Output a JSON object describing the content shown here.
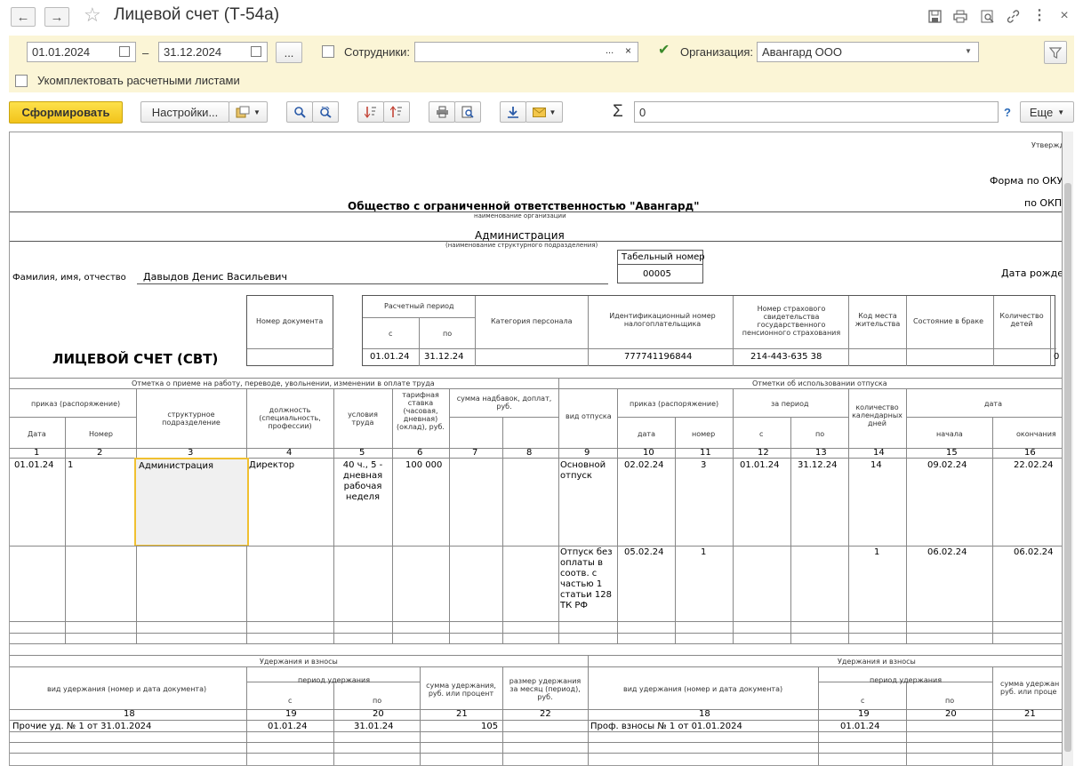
{
  "window": {
    "title": "Лицевой счет (Т-54а)",
    "nav_back": "←",
    "nav_forward": "→",
    "star": "☆"
  },
  "filter": {
    "date_from": "01.01.2024",
    "dash": "–",
    "date_to": "31.12.2024",
    "dots": "...",
    "employees_label": "Сотрудники:",
    "employees_value": "",
    "x": "×",
    "org_label": "Организация:",
    "org_value": "Авангард ООО",
    "complete_label": "Укомплектовать расчетными листами"
  },
  "toolbar": {
    "generate": "Сформировать",
    "settings": "Настройки...",
    "sigma": "Σ",
    "sum_value": "0",
    "help": "?",
    "more": "Еще"
  },
  "doc": {
    "approved": "Утвержд",
    "okud": "Форма по ОКУ",
    "okpo": "по ОКП",
    "org": "Общество с ограниченной ответственностью \"Авангард\"",
    "org_caption": "наименование организации",
    "dept": "Администрация",
    "dept_caption": "(наименование структурного подразделения)",
    "tab_label": "Табельный номер",
    "tab_num": "00005",
    "fio_label": "Фамилия, имя, отчество",
    "fio": "Давыдов Денис Васильевич",
    "birth": "Дата рожден",
    "heading": "ЛИЦЕВОЙ СЧЕТ (СВТ)",
    "h_docnum": "Номер документа",
    "h_period": "Расчетный период",
    "h_from": "с",
    "h_to": "по",
    "h_category": "Категория персонала",
    "h_inn": "Идентификационный номер налогоплательщика",
    "h_snils": "Номер страхового свидетельства государственного пенсионного страхования",
    "h_residence": "Код места жительства",
    "h_marital": "Состояние в браке",
    "h_children": "Количество детей",
    "v_from": "01.01.24",
    "v_to": "31.12.24",
    "v_inn": "777741196844",
    "v_snils": "214-443-635 38",
    "v_zero": "0",
    "sec_hire": "Отметка о приеме на работу, переводе, увольнении, изменении в оплате труда",
    "sec_vac": "Отметки об использовании отпуска",
    "c_order": "приказ (распоряжение)",
    "c_date": "Дата",
    "c_number": "Номер",
    "c_unit": "структурное подразделение",
    "c_position": "должность (специальность, профессии)",
    "c_cond": "условия труда",
    "c_rate": "тарифная ставка (часовая, дневная) (оклад), руб.",
    "c_bonus": "сумма надбавок, доплат, руб.",
    "c_vtype": "вид отпуска",
    "c_vorder": "приказ (распоряжение)",
    "c_vdate": "дата",
    "c_vnum": "номер",
    "c_vperiod": "за период",
    "c_vs": "с",
    "c_vpo": "по",
    "c_vdays": "количество календарных дней",
    "c_vdates": "дата",
    "c_vstart": "начала",
    "c_vend": "окончания",
    "nums": [
      "1",
      "2",
      "3",
      "4",
      "5",
      "6",
      "7",
      "8",
      "9",
      "10",
      "11",
      "12",
      "13",
      "14",
      "15",
      "16"
    ],
    "r1": {
      "date": "01.01.24",
      "num": "1",
      "unit": "Администрация",
      "pos": "Директор",
      "cond": "40 ч., 5 - дневная рабочая неделя",
      "rate": "100 000",
      "vtype": "Основной отпуск",
      "vdate": "02.02.24",
      "vnum": "3",
      "vs": "01.01.24",
      "vpo": "31.12.24",
      "days": "14",
      "start": "09.02.24",
      "end": "22.02.24"
    },
    "r2": {
      "vtype": "Отпуск без оплаты в соотв. с частью 1 статьи 128 ТК РФ",
      "vdate": "05.02.24",
      "vnum": "1",
      "days": "1",
      "start": "06.02.24",
      "end": "06.02.24"
    },
    "sec_ded": "Удержания и взносы",
    "d_type": "вид удержания (номер и дата документа)",
    "d_period": "период удержания",
    "d_s": "с",
    "d_po": "по",
    "d_sum": "сумма удержания, руб. или процент",
    "d_size": "размер удержания за месяц (период), руб.",
    "d_sum_short": "сумма удержан руб. или проце",
    "dnums": [
      "18",
      "19",
      "20",
      "21",
      "22",
      "18",
      "19",
      "20",
      "21"
    ],
    "dr1": {
      "type": "Прочие уд. № 1 от 31.01.2024",
      "s": "01.01.24",
      "po": "31.01.24",
      "sum": "105"
    },
    "dr2": {
      "type": "Проф. взносы № 1 от 01.01.2024",
      "s": "01.01.24"
    }
  }
}
